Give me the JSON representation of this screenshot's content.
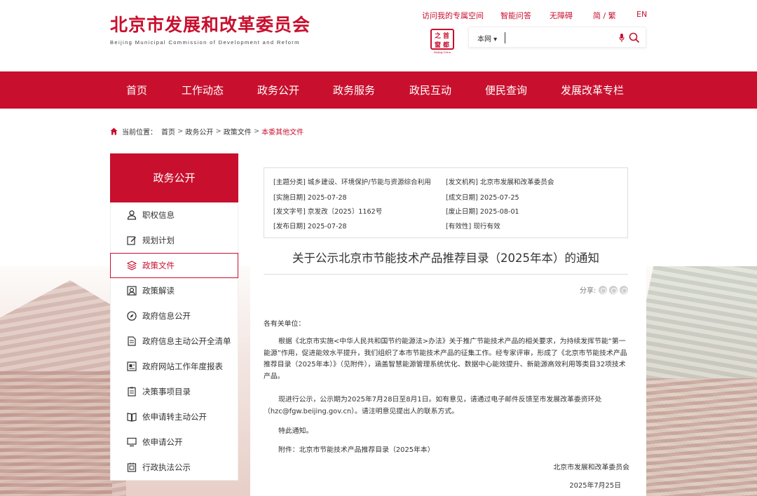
{
  "header": {
    "title_cn": "北京市发展和改革委员会",
    "title_en": "Beijing Municipal Commission of Development and Reform",
    "toplinks": [
      "访问我的专属空间",
      "智能问答",
      "无障碍",
      "简 / 繁",
      "EN"
    ],
    "seal_chars": [
      "首",
      "都",
      "之",
      "窗"
    ],
    "seal_caption": "Beijing·China",
    "search_scope": "本网",
    "search_value": ""
  },
  "nav": {
    "items": [
      "首页",
      "工作动态",
      "政务公开",
      "政务服务",
      "政民互动",
      "便民查询",
      "发展改革专栏"
    ]
  },
  "breadcrumb": {
    "prefix": "当前位置：",
    "items": [
      "首页",
      "政务公开",
      "政策文件",
      "本委其他文件"
    ],
    "separator": ">"
  },
  "sidebar": {
    "title": "政务公开",
    "items": [
      {
        "label": "职权信息",
        "icon": "person-icon"
      },
      {
        "label": "规划计划",
        "icon": "edit-icon"
      },
      {
        "label": "政策文件",
        "icon": "layers-icon",
        "active": true
      },
      {
        "label": "政策解读",
        "icon": "reading-icon"
      },
      {
        "label": "政府信息公开",
        "icon": "compass-icon"
      },
      {
        "label": "政府信息主动公开全清单",
        "icon": "document-icon"
      },
      {
        "label": "政府网站工作年度报表",
        "icon": "report-icon"
      },
      {
        "label": "决策事项目录",
        "icon": "checklist-icon"
      },
      {
        "label": "依申请转主动公开",
        "icon": "book-icon"
      },
      {
        "label": "依申请公开",
        "icon": "monitor-icon"
      },
      {
        "label": "行政执法公示",
        "icon": "clipboard-icon"
      }
    ]
  },
  "meta": {
    "topic": "[主题分类] 城乡建设、环境保护/节能与资源综合利用",
    "issuer": "[发文机构] 北京市发展和改革委员会",
    "impl_date": "[实施日期] 2025-07-28",
    "written_date": "[成文日期] 2025-07-25",
    "doc_no": "[发文字号] 京发改〔2025〕1162号",
    "expire_date": "[废止日期] 2025-08-01",
    "pub_date": "[发布日期] 2025-07-28",
    "validity": "[有效性] 现行有效"
  },
  "article": {
    "title": "关于公示北京市节能技术产品推荐目录（2025年本）的通知",
    "share_label": "分享:",
    "salutation": "各有关单位：",
    "para1": "根据《北京市实施<中华人民共和国节约能源法>办法》关于推广节能技术产品的相关要求，为持续发挥节能“第一能源”作用，促进能效水平提升，我们组织了本市节能技术产品的征集工作。经专家评审，形成了《北京市节能技术产品推荐目录（2025年本）》（见附件），涵盖智慧能源管理系统优化、数据中心能效提升、新能源高效利用等类目32项技术产品。",
    "para2": "现进行公示，公示期为2025年7月28日至8月1日。如有意见，请通过电子邮件反馈至市发展改革委资环处（hzc@fgw.beijing.gov.cn）。请注明意见提出人的联系方式。",
    "para3": "特此通知。",
    "attachment": "附件：北京市节能技术产品推荐目录（2025年本）",
    "sign_org": "北京市发展和改革委员会",
    "sign_date": "2025年7月25日"
  },
  "colors": {
    "brand_red": "#c8102e",
    "text": "#333333"
  }
}
